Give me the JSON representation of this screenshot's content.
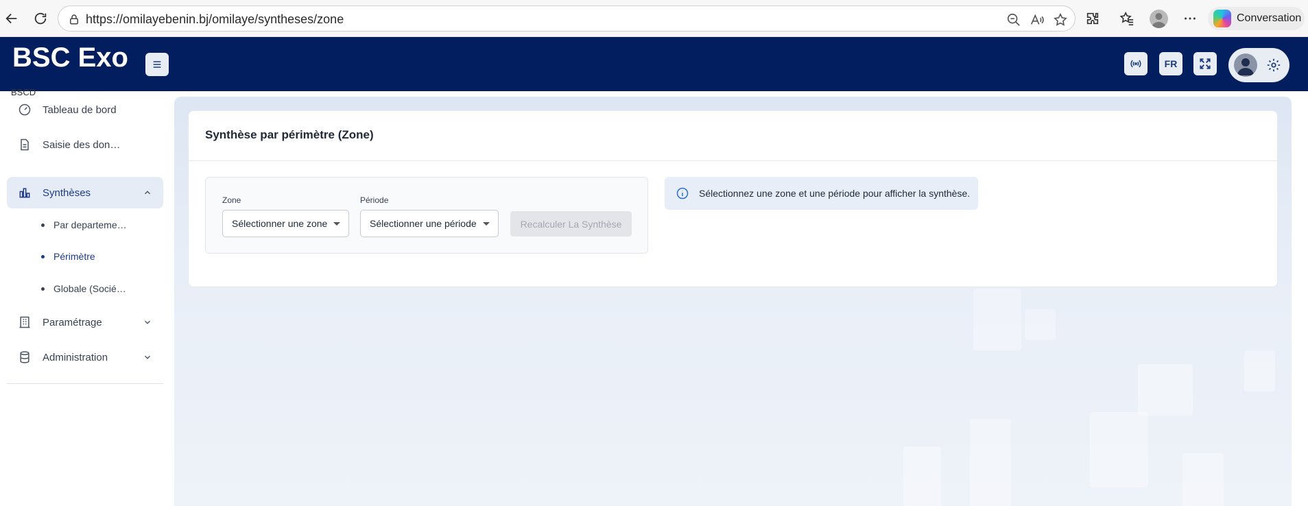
{
  "browser": {
    "url": "https://omilayebenin.bj/omilaye/syntheses/zone",
    "copilot_label": "Conversation"
  },
  "header": {
    "brand": "BSC Exo",
    "lang_label": "FR"
  },
  "sidebar": {
    "section_label": "BSCD",
    "items": [
      {
        "label": "Tableau de bord",
        "icon": "dashboard-icon"
      },
      {
        "label": "Saisie des don…",
        "icon": "document-icon"
      },
      {
        "label": "Synthèses",
        "icon": "chart-icon",
        "active": true,
        "expanded": true
      },
      {
        "label": "Paramétrage",
        "icon": "building-icon"
      },
      {
        "label": "Administration",
        "icon": "database-icon"
      }
    ],
    "sub_items": [
      {
        "label": "Par departeme…"
      },
      {
        "label": "Périmètre",
        "active": true
      },
      {
        "label": "Globale (Socié…"
      }
    ]
  },
  "main": {
    "title": "Synthèse par périmètre (Zone)",
    "filters": {
      "zone_label": "Zone",
      "zone_value": "Sélectionner une zone",
      "period_label": "Période",
      "period_value": "Sélectionner une période",
      "recalc_label": "Recalculer La Synthèse"
    },
    "info_text": "Sélectionnez une zone et une période pour afficher la synthèse."
  },
  "colors": {
    "header_bg": "#021e5f",
    "active_bg": "#e6ecf6",
    "active_text": "#1e3a8a",
    "info_bg": "#e7eef8"
  }
}
